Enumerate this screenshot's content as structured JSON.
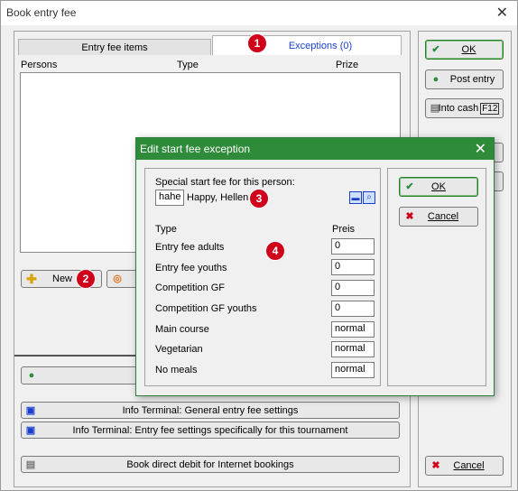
{
  "window": {
    "title": "Book entry fee"
  },
  "tabs": [
    {
      "label": "Entry fee items"
    },
    {
      "label": "Exceptions (0)"
    }
  ],
  "list": {
    "columns": [
      "Persons",
      "Type",
      "Prize"
    ]
  },
  "left_buttons": {
    "new_label": "New"
  },
  "bottom_buttons": [
    {
      "label": "Info Terminal: General entry fee settings"
    },
    {
      "label": "Info Terminal: Entry fee settings specifically for this tournament"
    },
    {
      "label": "Book direct debit for Internet bookings"
    }
  ],
  "right_buttons": {
    "ok_label": "OK",
    "post_label": "Post entry",
    "cash_label": "Into cash",
    "cash_key": "F12",
    "cancel_label": "Cancel"
  },
  "badges": [
    "1",
    "2",
    "3",
    "4"
  ],
  "dialog": {
    "title": "Edit start fee exception",
    "person_label": "Special start fee for this person:",
    "person_code": "hahe",
    "person_name": "Happy, Hellen",
    "col_type": "Type",
    "col_price": "Preis",
    "rows": [
      {
        "type": "Entry fee adults",
        "value": "0"
      },
      {
        "type": "Entry fee youths",
        "value": "0"
      },
      {
        "type": "Competition GF",
        "value": "0"
      },
      {
        "type": "Competition GF youths",
        "value": "0"
      },
      {
        "type": "Main course",
        "value": "normal"
      },
      {
        "type": "Vegetarian",
        "value": "normal"
      },
      {
        "type": "No meals",
        "value": "normal"
      }
    ],
    "ok_label": "OK",
    "cancel_label": "Cancel"
  },
  "colors": {
    "accent": "#2e8b3a",
    "badge": "#d0021b",
    "link": "#1a3fcf"
  }
}
